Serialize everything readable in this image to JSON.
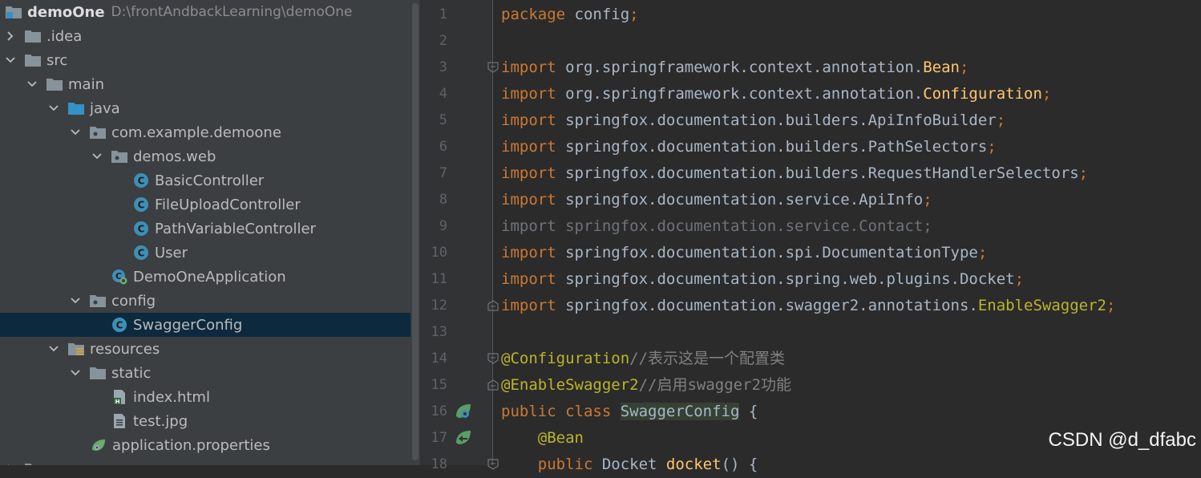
{
  "project": {
    "root_name": "demoOne",
    "root_path": "D:\\frontAndbackLearning\\demoOne",
    "nodes": [
      {
        "label": ".idea"
      },
      {
        "label": "src"
      },
      {
        "label": "main"
      },
      {
        "label": "java"
      },
      {
        "label": "com.example.demoone"
      },
      {
        "label": "demos.web"
      },
      {
        "label": "BasicController"
      },
      {
        "label": "FileUploadController"
      },
      {
        "label": "PathVariableController"
      },
      {
        "label": "User"
      },
      {
        "label": "DemoOneApplication"
      },
      {
        "label": "config"
      },
      {
        "label": "SwaggerConfig"
      },
      {
        "label": "resources"
      },
      {
        "label": "static"
      },
      {
        "label": "index.html"
      },
      {
        "label": "test.jpg"
      },
      {
        "label": "application.properties"
      }
    ],
    "selected": "SwaggerConfig"
  },
  "editor": {
    "line_numbers": [
      "1",
      "2",
      "3",
      "4",
      "5",
      "6",
      "7",
      "8",
      "9",
      "10",
      "11",
      "12",
      "13",
      "14",
      "15",
      "16",
      "17",
      "18"
    ],
    "lines": [
      {
        "kw": "package",
        "rest": " config",
        "semi": ";"
      },
      {},
      {
        "kw": "import",
        "rest": " org.springframework.context.annotation.",
        "ty": "Bean",
        "semi": ";"
      },
      {
        "kw": "import",
        "rest": " org.springframework.context.annotation.",
        "ty": "Configuration",
        "semi": ";"
      },
      {
        "kw": "import",
        "rest": " springfox.documentation.builders.ApiInfoBuilder",
        "semi": ";"
      },
      {
        "kw": "import",
        "rest": " springfox.documentation.builders.PathSelectors",
        "semi": ";"
      },
      {
        "kw": "import",
        "rest": " springfox.documentation.builders.RequestHandlerSelectors",
        "semi": ";"
      },
      {
        "kw": "import",
        "rest": " springfox.documentation.service.ApiInfo",
        "semi": ";"
      },
      {
        "text": "import springfox.documentation.service.Contact;"
      },
      {
        "kw": "import",
        "rest": " springfox.documentation.spi.DocumentationType",
        "semi": ";"
      },
      {
        "kw": "import",
        "rest": " springfox.documentation.spring.web.plugins.Docket",
        "semi": ";"
      },
      {
        "kw": "import",
        "rest": " springfox.documentation.swagger2.annotations.",
        "ty": "EnableSwagger2",
        "semi": ";"
      },
      {},
      {
        "an": "@Configuration",
        "cm": "//表示这是一个配置类"
      },
      {
        "an": "@EnableSwagger2",
        "cm": "//启用swagger2功能"
      },
      {
        "kw": "public class ",
        "cls": "SwaggerConfig",
        "rest": " {"
      },
      {
        "indent": "    ",
        "an": "@Bean"
      },
      {
        "indent": "    ",
        "kw": "public",
        "rest": " Docket ",
        "ty": "docket",
        "tail": "() {"
      }
    ]
  },
  "watermark": "CSDN @d_dfabc",
  "colors": {
    "keyword": "#cc7832",
    "type": "#ffc66d",
    "annotation": "#bbb529",
    "comment": "#808080",
    "text": "#a9b7c6",
    "selection": "#0d293e"
  }
}
